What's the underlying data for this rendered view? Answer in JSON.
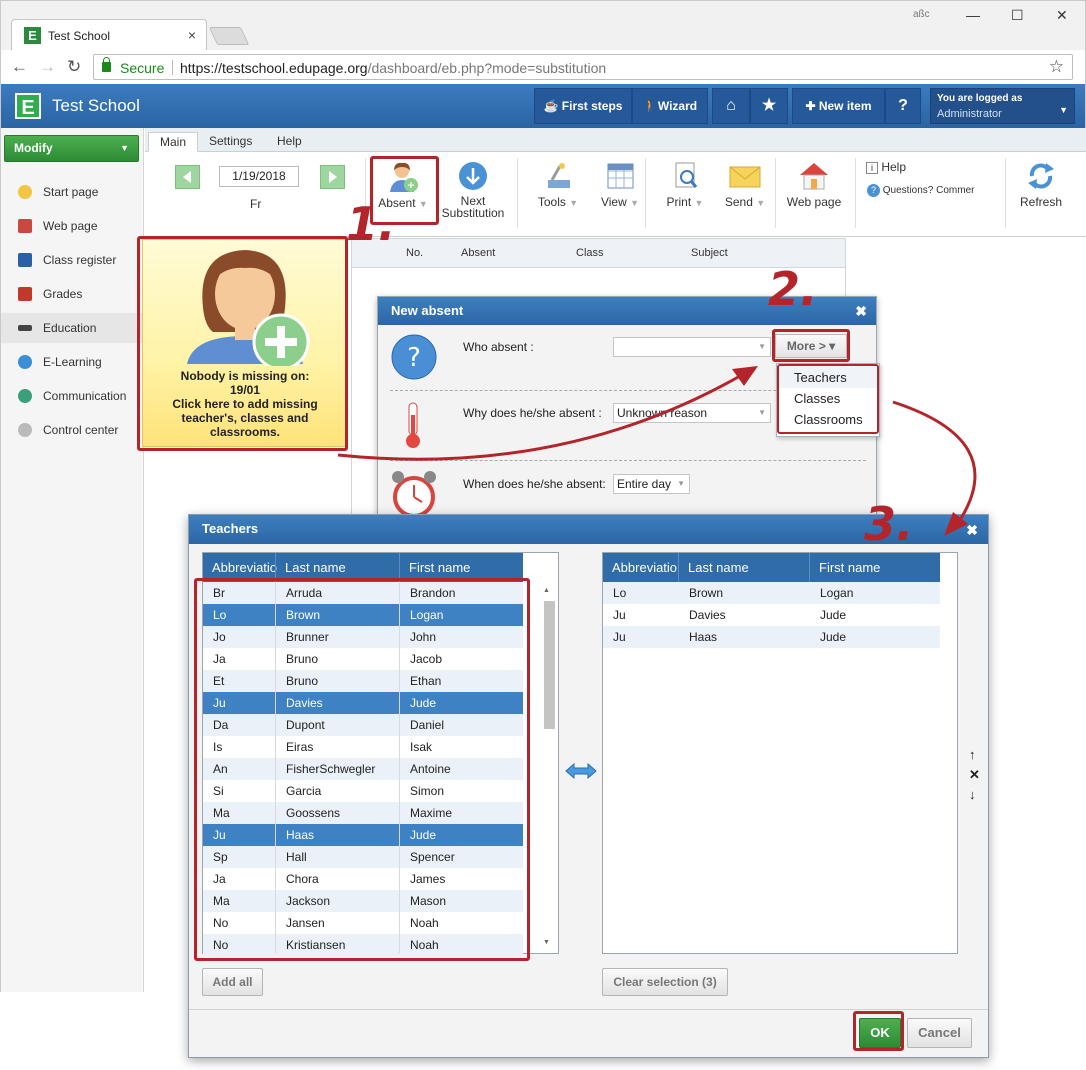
{
  "browser": {
    "tab_title": "Test School",
    "tab_favicon": "E",
    "url_secure": "Secure",
    "url_host": "https://testschool.edupage.org",
    "url_path": "/dashboard/eb.php?mode=substitution",
    "profile_badge": "aßc"
  },
  "header": {
    "logo": "E",
    "school": "Test School",
    "first_steps": "First steps",
    "wizard": "Wizard",
    "new_item": "New item",
    "help": "?",
    "login_line1": "You are logged as",
    "login_line2": "Administrator"
  },
  "sidebar": {
    "modify": "Modify",
    "items": [
      {
        "label": "Start page"
      },
      {
        "label": "Web page"
      },
      {
        "label": "Class register"
      },
      {
        "label": "Grades"
      },
      {
        "label": "Education"
      },
      {
        "label": "E-Learning"
      },
      {
        "label": "Communication"
      },
      {
        "label": "Control center"
      }
    ]
  },
  "ribbon": {
    "tabs": [
      "Main",
      "Settings",
      "Help"
    ],
    "date": "1/19/2018",
    "day": "Fr",
    "absent": "Absent",
    "next_sub1": "Next",
    "next_sub2": "Substitution",
    "tools": "Tools",
    "view": "View",
    "print": "Print",
    "send": "Send",
    "web_page": "Web page",
    "help": "Help",
    "questions": "Questions? Commer",
    "refresh": "Refresh"
  },
  "table_bg": {
    "headers": [
      "No.",
      "Absent",
      "Class",
      "Subject"
    ]
  },
  "nobody": {
    "line1": "Nobody is missing on:",
    "line2": "19/01",
    "line3": "Click here to add missing",
    "line4": "teacher's, classes and",
    "line5": "classrooms."
  },
  "new_absent": {
    "title": "New absent",
    "who": "Who absent :",
    "why": "Why does he/she absent :",
    "why_value": "Unknown reason",
    "when": "When does he/she absent:",
    "when_value": "Entire day",
    "more": "More > ▾"
  },
  "more_menu": [
    "Teachers",
    "Classes",
    "Classrooms"
  ],
  "teachers_dialog": {
    "title": "Teachers",
    "headers": [
      "Abbreviatio",
      "Last name",
      "First name"
    ],
    "rows": [
      [
        "Br",
        "Arruda",
        "Brandon"
      ],
      [
        "Lo",
        "Brown",
        "Logan"
      ],
      [
        "Jo",
        "Brunner",
        "John"
      ],
      [
        "Ja",
        "Bruno",
        "Jacob"
      ],
      [
        "Et",
        "Bruno",
        "Ethan"
      ],
      [
        "Ju",
        "Davies",
        "Jude"
      ],
      [
        "Da",
        "Dupont",
        "Daniel"
      ],
      [
        "Is",
        "Eiras",
        "Isak"
      ],
      [
        "An",
        "FisherSchwegler",
        "Antoine"
      ],
      [
        "Si",
        "Garcia",
        "Simon"
      ],
      [
        "Ma",
        "Goossens",
        "Maxime"
      ],
      [
        "Ju",
        "Haas",
        "Jude"
      ],
      [
        "Sp",
        "Hall",
        "Spencer"
      ],
      [
        "Ja",
        "Chora",
        "James"
      ],
      [
        "Ma",
        "Jackson",
        "Mason"
      ],
      [
        "No",
        "Jansen",
        "Noah"
      ],
      [
        "No",
        "Kristiansen",
        "Noah"
      ]
    ],
    "selected_rows": [
      1,
      5,
      11
    ],
    "selected": [
      [
        "Lo",
        "Brown",
        "Logan"
      ],
      [
        "Ju",
        "Davies",
        "Jude"
      ],
      [
        "Ju",
        "Haas",
        "Jude"
      ]
    ],
    "add_all": "Add all",
    "clear": "Clear selection (3)",
    "ok": "OK",
    "cancel": "Cancel"
  },
  "annotations": [
    "1.",
    "2.",
    "3."
  ],
  "colors": {
    "accent": "#2f6ca8",
    "annotation_red": "#b3252a",
    "ok_green": "#2e8b35"
  }
}
